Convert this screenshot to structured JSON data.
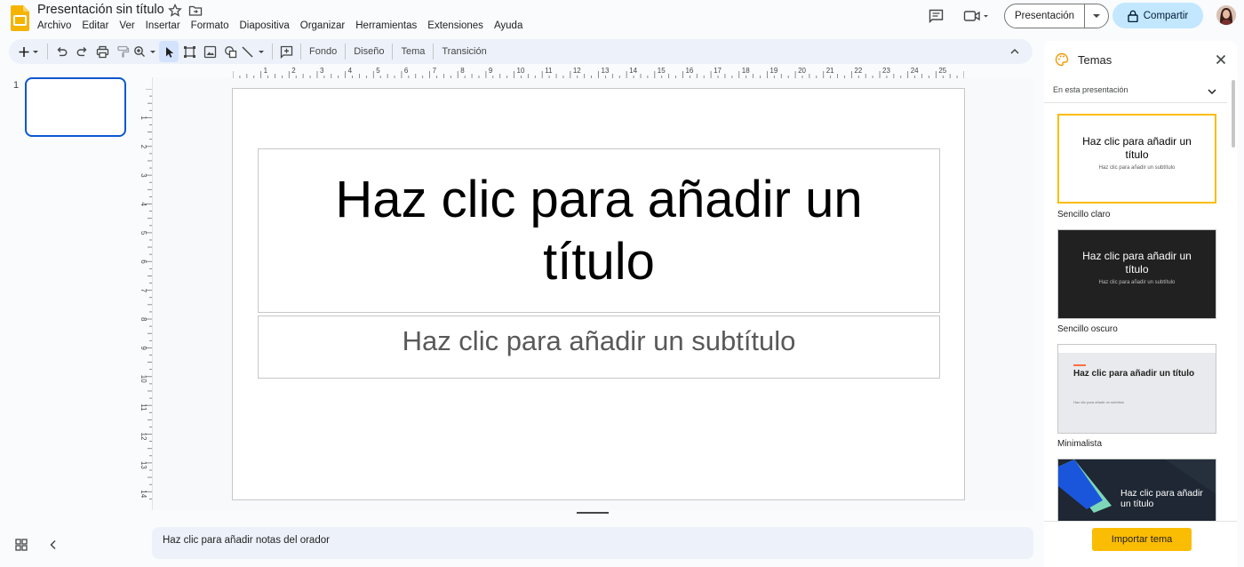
{
  "header": {
    "title": "Presentación sin título",
    "menu": [
      "Archivo",
      "Editar",
      "Ver",
      "Insertar",
      "Formato",
      "Diapositiva",
      "Organizar",
      "Herramientas",
      "Extensiones",
      "Ayuda"
    ],
    "present_label": "Presentación",
    "share_label": "Compartir"
  },
  "toolbar": {
    "fondo": "Fondo",
    "diseno": "Diseño",
    "tema": "Tema",
    "transicion": "Transición"
  },
  "rulers": {
    "h_labels": [
      "1",
      "2",
      "3",
      "4",
      "5",
      "6",
      "7",
      "8",
      "9",
      "10",
      "11",
      "12",
      "13",
      "14",
      "15",
      "16",
      "17",
      "18",
      "19",
      "20",
      "21",
      "22",
      "23",
      "24",
      "25"
    ],
    "v_labels": [
      "1",
      "2",
      "3",
      "4",
      "5",
      "6",
      "7",
      "8",
      "9",
      "10",
      "11",
      "12",
      "13",
      "14"
    ]
  },
  "filmstrip": {
    "slide_number": "1"
  },
  "slide": {
    "title_placeholder": "Haz clic para añadir un título",
    "subtitle_placeholder": "Haz clic para añadir un subtítulo"
  },
  "notes": {
    "placeholder": "Haz clic para añadir notas del orador"
  },
  "themes_panel": {
    "title": "Temas",
    "filter": "En esta presentación",
    "import_label": "Importar tema",
    "themes": [
      {
        "name": "Sencillo claro",
        "preview_title": "Haz clic para añadir un título",
        "preview_subtitle": "Haz clic para añadir un subtítulo"
      },
      {
        "name": "Sencillo oscuro",
        "preview_title": "Haz clic para añadir un título",
        "preview_subtitle": "Haz clic para añadir un subtítulo"
      },
      {
        "name": "Minimalista",
        "preview_title": "Haz clic para añadir un título",
        "preview_subtitle": "Haz clic para añadir un subtítulo"
      },
      {
        "name": "",
        "preview_title": "Haz clic para añadir un título",
        "preview_subtitle": ""
      }
    ]
  },
  "colors": {
    "accent": "#0b57d0",
    "share_bg": "#c2e7ff",
    "toolbar_bg": "#edf2fa",
    "theme_selected": "#fbbc04",
    "slides_logo": "#f4b400"
  }
}
